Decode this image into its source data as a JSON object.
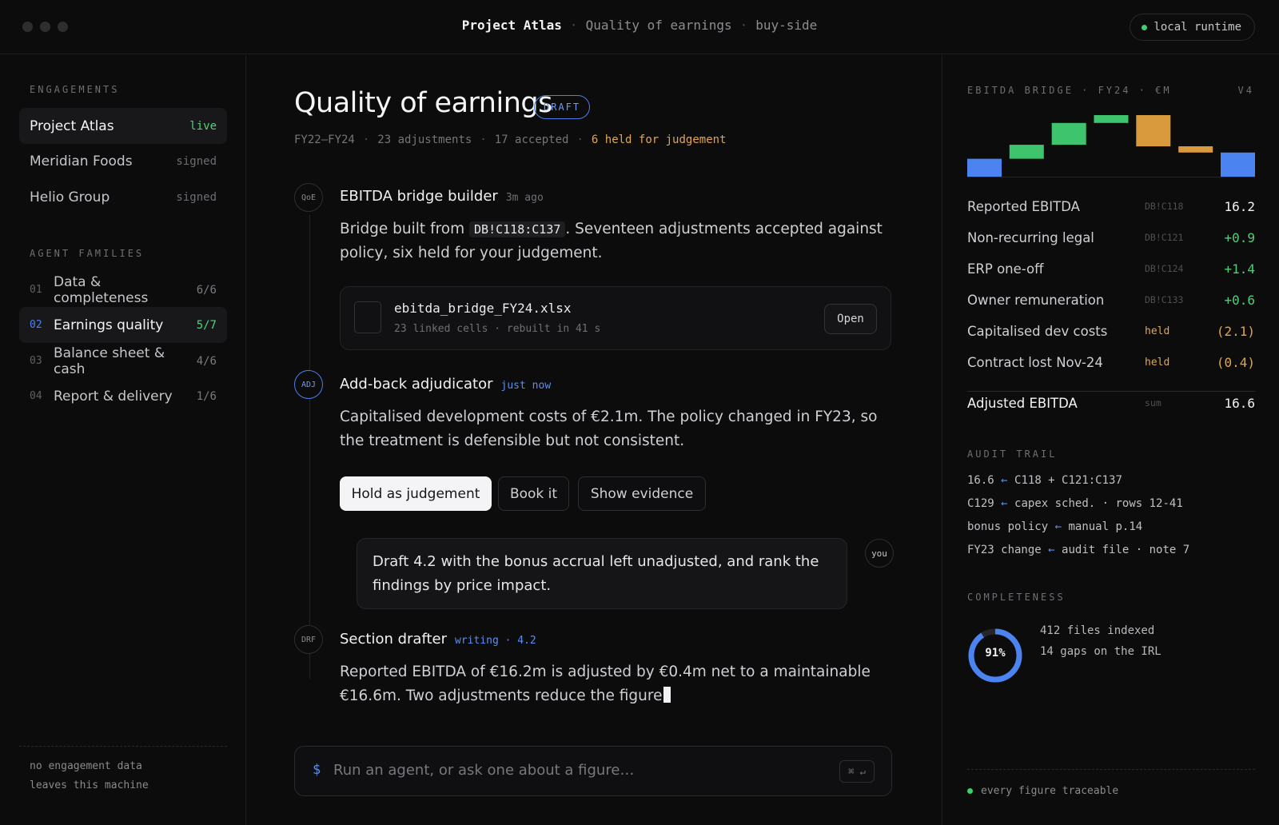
{
  "window": {
    "project": "Project Atlas",
    "subtitle": "Quality of earnings",
    "side": "buy-side",
    "runtime": "local runtime"
  },
  "sidebar": {
    "engagements_label": "ENGAGEMENTS",
    "engagements": [
      {
        "name": "Project Atlas",
        "status": "live"
      },
      {
        "name": "Meridian Foods",
        "status": "signed"
      },
      {
        "name": "Helio Group",
        "status": "signed"
      }
    ],
    "families_label": "AGENT FAMILIES",
    "families": [
      {
        "no": "01",
        "name": "Data & completeness",
        "count": "6/6"
      },
      {
        "no": "02",
        "name": "Earnings quality",
        "count": "5/7"
      },
      {
        "no": "03",
        "name": "Balance sheet & cash",
        "count": "4/6"
      },
      {
        "no": "04",
        "name": "Report & delivery",
        "count": "1/6"
      }
    ],
    "note_line1": "no engagement data",
    "note_line2": "leaves this machine"
  },
  "main": {
    "title": "Quality of earnings",
    "badge": "DRAFT",
    "meta": {
      "period": "FY22–FY24",
      "adjustments": "23 adjustments",
      "accepted": "17 accepted",
      "held": "6 held for judgement"
    },
    "events": [
      {
        "badge": "QoE",
        "title": "EBITDA bridge builder",
        "time": "3m ago",
        "body_pre": "Bridge built from",
        "body_code": "DB!C118:C137",
        "body_post": ". Seventeen adjustments accepted against policy, six held for your judgement.",
        "file": {
          "name": "ebitda_bridge_FY24.xlsx",
          "meta": "23 linked cells · rebuilt in 41 s",
          "action": "Open"
        }
      },
      {
        "badge": "ADJ",
        "title": "Add-back adjudicator",
        "time": "just now",
        "body": "Capitalised development costs of €2.1m. The policy changed in FY23, so the treatment is defensible but not consistent.",
        "actions": [
          "Hold as judgement",
          "Book it",
          "Show evidence"
        ]
      },
      {
        "badge": "DRF",
        "title": "Section drafter",
        "time": "writing · 4.2",
        "body": "Reported EBITDA of €16.2m is adjusted by €0.4m net to a maintainable €16.6m. Two adjustments reduce the figure"
      }
    ],
    "user_message": "Draft 4.2 with the bonus accrual left unadjusted, and rank the findings by price impact.",
    "user_avatar": "you",
    "input": {
      "prompt": "$",
      "placeholder": "Run an agent, or ask one about a figure…",
      "shortcut": "⌘ ↵"
    }
  },
  "right": {
    "bridge_label": "EBITDA BRIDGE · FY24 · €M",
    "version": "V4",
    "rows": [
      {
        "label": "Reported EBITDA",
        "ref": "DB!C118",
        "value": "16.2"
      },
      {
        "label": "Non-recurring legal",
        "ref": "DB!C121",
        "value": "+0.9"
      },
      {
        "label": "ERP one-off",
        "ref": "DB!C124",
        "value": "+1.4"
      },
      {
        "label": "Owner remuneration",
        "ref": "DB!C133",
        "value": "+0.6"
      },
      {
        "label": "Capitalised dev costs",
        "ref": "held",
        "value": "(2.1)"
      },
      {
        "label": "Contract lost Nov-24",
        "ref": "held",
        "value": "(0.4)"
      }
    ],
    "total": {
      "label": "Adjusted EBITDA",
      "ref": "sum",
      "value": "16.6"
    },
    "audit_label": "AUDIT TRAIL",
    "audit": [
      {
        "left": "16.6",
        "right": "C118 + C121:C137"
      },
      {
        "left": "C129",
        "right": "capex sched. · rows 12-41"
      },
      {
        "left": "bonus policy",
        "right": "manual p.14"
      },
      {
        "left": "FY23 change",
        "right": "audit file · note 7"
      }
    ],
    "completeness_label": "COMPLETENESS",
    "completeness_pct": "91%",
    "completeness_value": 0.91,
    "files_indexed": "412 files indexed",
    "gaps": "14 gaps on the IRL",
    "footer": "every figure traceable"
  },
  "chart_data": {
    "type": "bar",
    "categories": [
      "Reported EBITDA",
      "Non-recurring legal",
      "ERP one-off",
      "Owner remuneration",
      "Capitalised dev costs",
      "Contract lost Nov-24",
      "Adjusted EBITDA"
    ],
    "values": [
      16.2,
      0.9,
      1.4,
      0.6,
      -2.1,
      -0.4,
      16.6
    ],
    "kinds": [
      "total",
      "up",
      "up",
      "up",
      "held",
      "held",
      "total"
    ],
    "colors": {
      "total": "#4b84f0",
      "up": "#3ec46d",
      "held": "#d89a3c"
    }
  },
  "colors": {
    "accent": "#4b84f0",
    "positive": "#4fcf7b",
    "warning": "#e2a64a"
  }
}
